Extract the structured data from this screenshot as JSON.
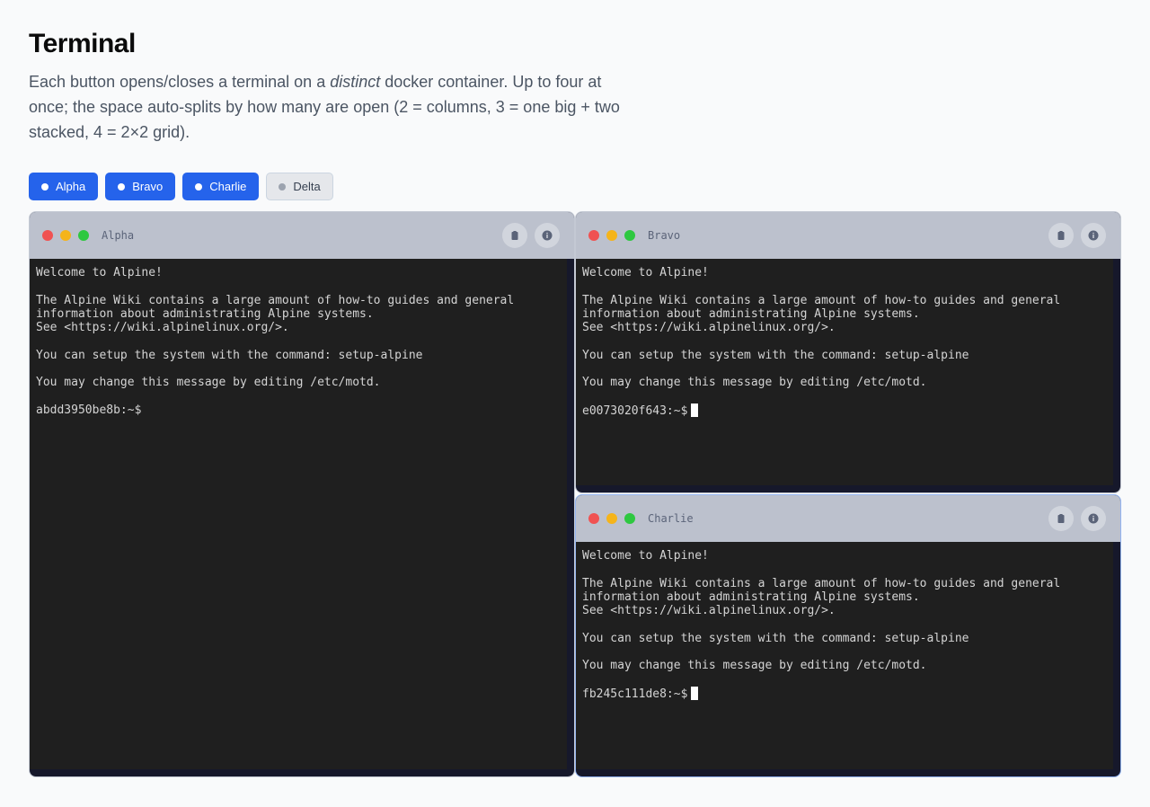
{
  "header": {
    "title": "Terminal",
    "description_pre": "Each button opens/closes a terminal on a ",
    "description_em": "distinct",
    "description_post": " docker container. Up to four at once; the space auto-splits by how many are open (2 = columns, 3 = one big + two stacked, 4 = 2×2 grid)."
  },
  "buttons": [
    {
      "label": "Alpha",
      "active": true
    },
    {
      "label": "Bravo",
      "active": true
    },
    {
      "label": "Charlie",
      "active": true
    },
    {
      "label": "Delta",
      "active": false
    }
  ],
  "colors": {
    "accent": "#2563eb",
    "titlebar": "#bcc1cd",
    "terminal_bg": "#1f1f1f",
    "traffic_red": "#f05252",
    "traffic_yellow": "#f5b41a",
    "traffic_green": "#2ec840"
  },
  "icons": {
    "clear": "clipboard-icon",
    "info": "info-icon"
  },
  "terminals": [
    {
      "name": "Alpha",
      "motd": [
        "Welcome to Alpine!",
        "",
        "The Alpine Wiki contains a large amount of how-to guides and general",
        "information about administrating Alpine systems.",
        "See <https://wiki.alpinelinux.org/>.",
        "",
        "You can setup the system with the command: setup-alpine",
        "",
        "You may change this message by editing /etc/motd.",
        ""
      ],
      "prompt": "abdd3950be8b:~$",
      "cursor_visible": false
    },
    {
      "name": "Bravo",
      "motd": [
        "Welcome to Alpine!",
        "",
        "The Alpine Wiki contains a large amount of how-to guides and general",
        "information about administrating Alpine systems.",
        "See <https://wiki.alpinelinux.org/>.",
        "",
        "You can setup the system with the command: setup-alpine",
        "",
        "You may change this message by editing /etc/motd.",
        ""
      ],
      "prompt": "e0073020f643:~$",
      "cursor_visible": true
    },
    {
      "name": "Charlie",
      "motd": [
        "Welcome to Alpine!",
        "",
        "The Alpine Wiki contains a large amount of how-to guides and general",
        "information about administrating Alpine systems.",
        "See <https://wiki.alpinelinux.org/>.",
        "",
        "You can setup the system with the command: setup-alpine",
        "",
        "You may change this message by editing /etc/motd.",
        ""
      ],
      "prompt": "fb245c111de8:~$",
      "cursor_visible": true
    }
  ]
}
